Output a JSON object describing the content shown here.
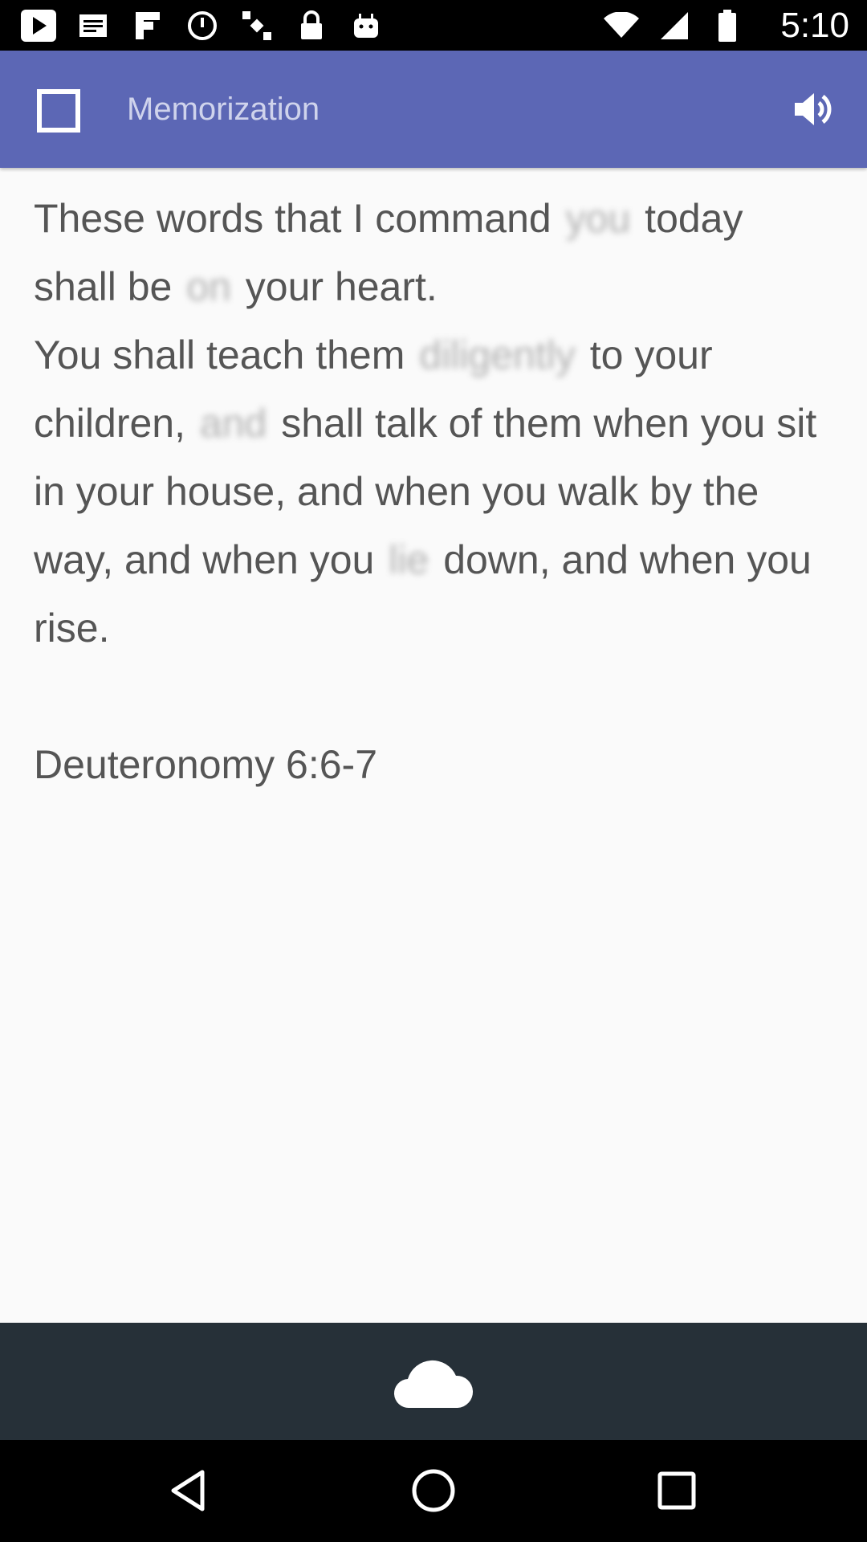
{
  "status_bar": {
    "time": "5:10",
    "left_icons": [
      "play-store-icon",
      "email-icon",
      "flipboard-icon",
      "fake-gps-icon",
      "satellite-icon",
      "lock-icon",
      "android-icon"
    ],
    "right_icons": [
      "wifi-icon",
      "signal-icon",
      "battery-icon"
    ]
  },
  "app_bar": {
    "title": "Memorization",
    "menu_icon": "square-icon",
    "action_icon": "speaker-icon"
  },
  "verse": {
    "line1_a": "These words that I command",
    "line1_hidden": "you",
    "line1_b": "today shall be",
    "line2_hidden": "on",
    "line2_b": "your heart.",
    "line3_a": "You shall teach them",
    "line3_hidden": "diligently",
    "line3_b": "to your children,",
    "line4_hidden": "and",
    "line4_b": "shall talk of them when you sit in your house, and when you walk by the way, and when you",
    "line5_hidden": "lie",
    "line5_b": "down, and when you rise."
  },
  "reference": "Deuteronomy 6:6-7",
  "bottom_bar": {
    "action_icon": "cloud-icon"
  },
  "nav_bar": {
    "buttons": [
      "back-icon",
      "home-icon",
      "recents-icon"
    ]
  },
  "colors": {
    "app_bar": "#5c67b5",
    "bottom_bar": "#263038",
    "text": "#555555",
    "background": "#fafafa"
  }
}
